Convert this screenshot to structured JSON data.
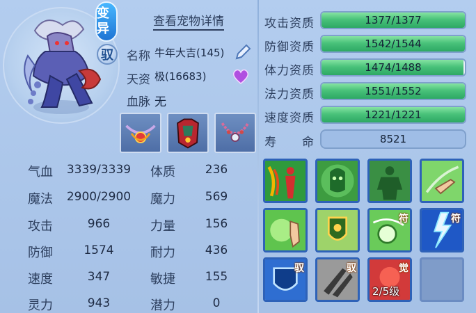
{
  "badges": {
    "mutant": "变异",
    "ride": "驭"
  },
  "header": {
    "detail_link": "查看宠物详情"
  },
  "info": {
    "name_label": "名称",
    "name_value": "牛年大吉(145)",
    "talent_label": "天资",
    "talent_value": "极(16683)",
    "blood_label": "血脉",
    "blood_value": "无"
  },
  "stats_left": [
    {
      "label": "气血",
      "value": "3339/3339"
    },
    {
      "label": "魔法",
      "value": "2900/2900"
    },
    {
      "label": "攻击",
      "value": "966"
    },
    {
      "label": "防御",
      "value": "1574"
    },
    {
      "label": "速度",
      "value": "347"
    },
    {
      "label": "灵力",
      "value": "943"
    }
  ],
  "stats_mid": [
    {
      "label": "体质",
      "value": "236"
    },
    {
      "label": "魔力",
      "value": "569"
    },
    {
      "label": "力量",
      "value": "156"
    },
    {
      "label": "耐力",
      "value": "436"
    },
    {
      "label": "敏捷",
      "value": "155"
    },
    {
      "label": "潜力",
      "value": "0"
    }
  ],
  "aptitudes": [
    {
      "label": "攻击资质",
      "value": "1377/1377",
      "current": 1377,
      "max": 1377
    },
    {
      "label": "防御资质",
      "value": "1542/1544",
      "current": 1542,
      "max": 1544
    },
    {
      "label": "体力资质",
      "value": "1474/1488",
      "current": 1474,
      "max": 1488
    },
    {
      "label": "法力资质",
      "value": "1551/1552",
      "current": 1551,
      "max": 1552
    },
    {
      "label": "速度资质",
      "value": "1221/1221",
      "current": 1221,
      "max": 1221
    }
  ],
  "life": {
    "label": "寿　　命",
    "value": "8521"
  },
  "skills": {
    "tag_fu": "符",
    "tag_yu": "驭",
    "tag_jue": "觉",
    "level": "2/5级"
  },
  "colors": {
    "bar_green": "#49c27a",
    "skill_border": "#2e62b8"
  }
}
